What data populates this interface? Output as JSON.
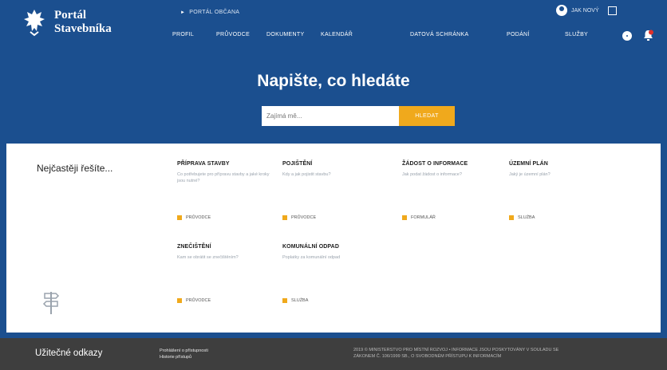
{
  "header": {
    "brand_line1": "Portál",
    "brand_line2": "Stavebníka",
    "portal_link": "PORTÁL OBČANA",
    "login": "JAK NOVÝ"
  },
  "nav": [
    {
      "label": "PROFIL"
    },
    {
      "label": "PRŮVODCE"
    },
    {
      "label": "DOKUMENTY"
    },
    {
      "label": "KALENDÁŘ"
    },
    {
      "label": "DATOVÁ SCHRÁNKA"
    },
    {
      "label": "PODÁNÍ"
    },
    {
      "label": "SLUŽBY"
    }
  ],
  "hero": {
    "title": "Napište, co hledáte",
    "search_placeholder": "Zajímá mě...",
    "search_button": "HLEDAT"
  },
  "faq": {
    "title": "Nejčastěji řešíte...",
    "cards": [
      {
        "title": "PŘÍPRAVA STAVBY",
        "text": "Co potřebujete pro přípravu stavby a jaké kroky jsou nutné?",
        "tag": "PRŮVODCE"
      },
      {
        "title": "POJIŠTĚNÍ",
        "text": "Kdy a jak pojistit stavbu?",
        "tag": "PRŮVODCE"
      },
      {
        "title": "ŽÁDOST O INFORMACE",
        "text": "Jak podat žádost o informace?",
        "tag": "FORMULÁŘ"
      },
      {
        "title": "ÚZEMNÍ PLÁN",
        "text": "Jaký je územní plán?",
        "tag": "SLUŽBA"
      },
      {
        "title": "ZNEČIŠTĚNÍ",
        "text": "Kam se obrátit se znečištěním?",
        "tag": "PRŮVODCE"
      },
      {
        "title": "KOMUNÁLNÍ ODPAD",
        "text": "Poplatky za komunální odpad",
        "tag": "SLUŽBA"
      }
    ]
  },
  "footer": {
    "title": "Užitečné odkazy",
    "link1": "Prohlášení o přístupnosti",
    "link2": "Historie přístupů",
    "note_line1": "2019 © MINISTERSTVO PRO MÍSTNÍ ROZVOJ • INFORMACE JSOU POSKYTOVÁNY V SOULADU SE",
    "note_line2": "ZÁKONEM Č. 106/1999 SB., O SVOBODNÉM PŘÍSTUPU K INFORMACÍM"
  },
  "colors": {
    "primary": "#1b4f8f",
    "accent": "#f0a91c",
    "footer": "#3e3e3e"
  },
  "icons": [
    "crest-logo-icon",
    "arrow-icon",
    "user-icon",
    "logout-icon",
    "gear-icon",
    "notification-icon",
    "signpost-icon"
  ]
}
